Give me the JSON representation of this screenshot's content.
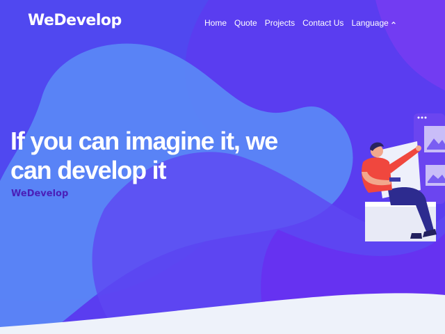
{
  "brand": {
    "name": "WeDevelop"
  },
  "nav": {
    "items": [
      {
        "label": "Home"
      },
      {
        "label": "Quote"
      },
      {
        "label": "Projects"
      },
      {
        "label": "Contact Us"
      },
      {
        "label": "Language"
      }
    ]
  },
  "hero": {
    "headline": "If you can imagine it, we can develop it",
    "tagline": "WeDevelop"
  },
  "icons": [
    "chevron-up-icon",
    "developer-illustration"
  ],
  "colors": {
    "background_main": "#5a3df0",
    "background_light": "#5b8ef7",
    "wave_purple": "#6a2cf0",
    "footer_wave": "#eef2fa",
    "tagline": "#4a1fb8",
    "text": "#ffffff"
  }
}
